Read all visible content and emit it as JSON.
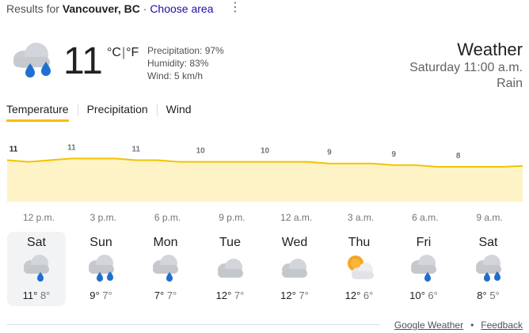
{
  "header": {
    "results_prefix": "Results for",
    "location": "Vancouver, BC",
    "separator": "·",
    "choose_area": "Choose area",
    "more_icon": "more-vert-icon"
  },
  "current": {
    "icon": "rain-cloud-icon",
    "temperature": "11",
    "unit_c": "°C",
    "unit_sep": "|",
    "unit_f": "°F",
    "precipitation": "Precipitation: 97%",
    "humidity": "Humidity: 83%",
    "wind": "Wind: 5 km/h"
  },
  "summary": {
    "title": "Weather",
    "time": "Saturday 11:00 a.m.",
    "condition": "Rain"
  },
  "tabs": [
    {
      "label": "Temperature",
      "active": true
    },
    {
      "label": "Precipitation",
      "active": false
    },
    {
      "label": "Wind",
      "active": false
    }
  ],
  "chart_data": {
    "type": "area",
    "x": [
      "11 a.m.",
      "12 p.m.",
      "1 p.m.",
      "2 p.m.",
      "3 p.m.",
      "4 p.m.",
      "5 p.m.",
      "6 p.m.",
      "7 p.m.",
      "8 p.m.",
      "9 p.m.",
      "10 p.m.",
      "11 p.m.",
      "12 a.m.",
      "1 a.m.",
      "2 a.m.",
      "3 a.m.",
      "4 a.m.",
      "5 a.m.",
      "6 a.m.",
      "7 a.m.",
      "8 a.m.",
      "9 a.m.",
      "10 a.m.",
      "11 a.m."
    ],
    "values": [
      11,
      10.8,
      11,
      11.2,
      11.2,
      11.2,
      11,
      11,
      10.8,
      10.8,
      10.8,
      10.8,
      10.8,
      10.8,
      10.8,
      10.6,
      10.6,
      10.6,
      10.4,
      10.4,
      10.2,
      10.2,
      10.2,
      10.2,
      10.3
    ],
    "point_labels": [
      {
        "index": 0,
        "text": "11"
      },
      {
        "index": 3,
        "text": "11"
      },
      {
        "index": 6,
        "text": "11"
      },
      {
        "index": 9,
        "text": "10"
      },
      {
        "index": 12,
        "text": "10"
      },
      {
        "index": 15,
        "text": "9"
      },
      {
        "index": 18,
        "text": "9"
      },
      {
        "index": 21,
        "text": "8"
      }
    ],
    "x_tick_labels": [
      "12 p.m.",
      "3 p.m.",
      "6 p.m.",
      "9 p.m.",
      "12 a.m.",
      "3 a.m.",
      "6 a.m.",
      "9 a.m."
    ],
    "ylim": [
      6,
      12
    ],
    "line_color": "#f2c300",
    "fill_color": "#fef3c6",
    "grid": false
  },
  "forecast": [
    {
      "day": "Sat",
      "icon": "rain-cloud-icon",
      "high": "11°",
      "low": "8°",
      "selected": true
    },
    {
      "day": "Sun",
      "icon": "heavy-rain-cloud-icon",
      "high": "9°",
      "low": "7°",
      "selected": false
    },
    {
      "day": "Mon",
      "icon": "rain-cloud-icon",
      "high": "7°",
      "low": "7°",
      "selected": false
    },
    {
      "day": "Tue",
      "icon": "cloud-icon",
      "high": "12°",
      "low": "7°",
      "selected": false
    },
    {
      "day": "Wed",
      "icon": "cloud-icon",
      "high": "12°",
      "low": "7°",
      "selected": false
    },
    {
      "day": "Thu",
      "icon": "partly-cloudy-icon",
      "high": "12°",
      "low": "6°",
      "selected": false
    },
    {
      "day": "Fri",
      "icon": "rain-cloud-icon",
      "high": "10°",
      "low": "6°",
      "selected": false
    },
    {
      "day": "Sat",
      "icon": "heavy-rain-cloud-icon",
      "high": "8°",
      "low": "5°",
      "selected": false
    }
  ],
  "footer": {
    "source": "Google Weather",
    "separator": "•",
    "feedback": "Feedback"
  }
}
